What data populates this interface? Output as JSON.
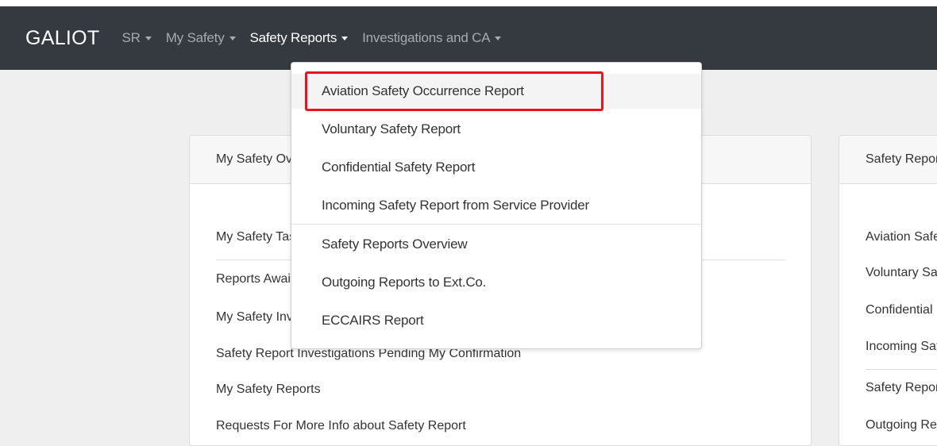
{
  "navbar": {
    "brand": "GALIOT",
    "items": [
      {
        "label": "SR"
      },
      {
        "label": "My Safety"
      },
      {
        "label": "Safety Reports"
      },
      {
        "label": "Investigations and CA"
      }
    ]
  },
  "left_card": {
    "header": "My Safety Overview",
    "items": [
      "My Safety Tasks",
      "Reports Awaiting Action",
      "My Safety Investigations",
      "Safety Report Investigations Pending My Confirmation",
      "My Safety Reports",
      "Requests For More Info about Safety Report"
    ]
  },
  "right_card": {
    "header": "Safety Reports",
    "items": [
      "Aviation Safety Occurrence Report",
      "Voluntary Safety Report",
      "Confidential Safety Report",
      "Incoming Safety Report from Service Provider",
      "Safety Reports Overview",
      "Outgoing Reports to Ext.Co."
    ]
  },
  "dropdown": {
    "items": [
      "Aviation Safety Occurrence Report",
      "Voluntary Safety Report",
      "Confidential Safety Report",
      "Incoming Safety Report from Service Provider",
      "Safety Reports Overview",
      "Outgoing Reports to Ext.Co.",
      "ECCAIRS Report"
    ]
  },
  "colors": {
    "navbar_bg": "#343a40",
    "highlight": "#e8141b",
    "page_bg": "#efefef"
  }
}
